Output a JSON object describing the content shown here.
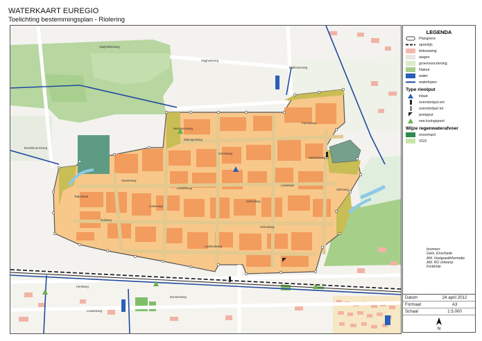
{
  "title": "WATERKAART EUREGIO",
  "subtitle": "Toelichting bestemmingsplan - Riolering",
  "colors": {
    "plangebied_fill": "#f7c88a",
    "bebouwing": "#f29c5e",
    "wegen": "#e3c98f",
    "groenvoorziening": "#c9bd55",
    "natuur": "#a6d08a",
    "water": "#2a5fb8",
    "waterlopen": "#1e4aa0",
    "omverhard": "#2e8a4e",
    "vgs": "#c7e6a8",
    "spoor": "#222222",
    "boundary": "#555555",
    "forest": "#b7d6a0",
    "pond": "#74a08c",
    "canal": "#8fc8e8"
  },
  "legend": {
    "title": "LEGENDA",
    "items": [
      {
        "label": "Plangrens",
        "icon": "plangrens-icon"
      },
      {
        "label": "spoorlijn",
        "icon": "spoorlijn-icon"
      },
      {
        "label": "bebouwing",
        "icon": "bebouwing-swatch"
      },
      {
        "label": "wegen",
        "icon": "wegen-swatch"
      },
      {
        "label": "groenvoorziening",
        "icon": "groenvoorziening-swatch"
      },
      {
        "label": "Natuur",
        "icon": "natuur-swatch"
      },
      {
        "label": "water",
        "icon": "water-swatch"
      },
      {
        "label": "waterlopen",
        "icon": "waterlopen-icon"
      }
    ],
    "put_title": "Type rioolput",
    "put_items": [
      {
        "label": "inlaat",
        "icon": "inlaat-icon"
      },
      {
        "label": "overstortput-ext",
        "icon": "overstortput-ext-icon"
      },
      {
        "label": "overstortput int",
        "icon": "overstortput-int-icon"
      },
      {
        "label": "pompput",
        "icon": "pompput-icon"
      },
      {
        "label": "rwa lozingspunt",
        "icon": "rwa-lozingspunt-icon"
      }
    ],
    "afvoer_title": "Wijze regenwaterafvoer",
    "afvoer_items": [
      {
        "label": "onverhard",
        "icon": "onverhard-swatch"
      },
      {
        "label": "VGS",
        "icon": "vgs-swatch"
      }
    ]
  },
  "sources": {
    "label": "bronnen:",
    "lines": [
      "Gem. Enschede",
      "Afd. Vastgoedinformatie",
      "Afd. RO ontwerp",
      "Fortbride"
    ]
  },
  "info": {
    "datum_label": "Datum",
    "datum_value": "24 april 2012",
    "formaat_label": "Formaat",
    "formaat_value": "A3",
    "schaal_label": "Schaal",
    "schaal_value": "1:5.000",
    "north": "N"
  },
  "streets": [
    "Slaghekkenweg",
    "Slagheekweg",
    "Bakhovenweg",
    "Broekheurnerweg",
    "Eurmaweg",
    "Heeckerenweg",
    "Haurenweg",
    "Lansinkweg",
    "Eekhofweg",
    "Zuidweg",
    "Twijnstraat",
    "Hasselerweg",
    "Lankheetweg",
    "Schoolweg",
    "Dummerweg",
    "Hertsweg",
    "Louwesweg",
    "Watergorsweg",
    "Pantosweg",
    "Oslerweg",
    "Lamstraat",
    "Lanterweg"
  ]
}
